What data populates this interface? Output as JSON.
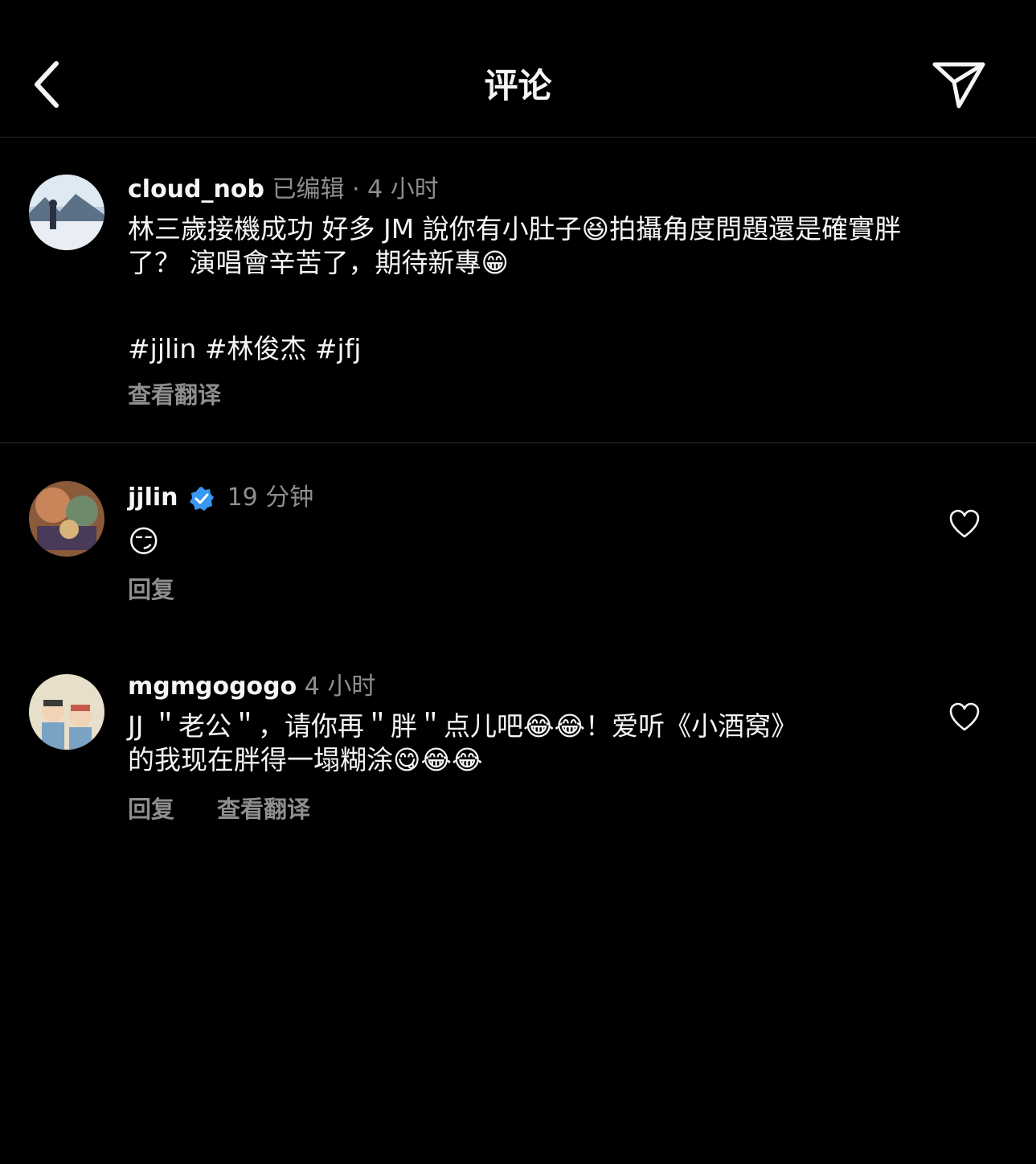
{
  "header": {
    "title": "评论",
    "back_icon": "chevron-left-icon",
    "send_icon": "paper-plane-icon"
  },
  "caption": {
    "username": "cloud_nob",
    "edited": "已编辑",
    "separator": "·",
    "time": "4 小时",
    "text_line1": "林三歲接機成功 好多 JM 說你有小肚子😆拍攝角度問題還是確實胖",
    "text_line2": "了？ 演唱會辛苦了，期待新專😁",
    "hashtags": "#jjlin #林俊杰 #jfj",
    "translate": "查看翻译"
  },
  "comments": [
    {
      "username": "jjlin",
      "verified_icon": "verified-badge-icon",
      "time": "19 分钟",
      "text": "😏",
      "reply": "回复",
      "like_icon": "heart-outline-icon"
    },
    {
      "username": "mgmgogogo",
      "time": "4 小时",
      "text_line1": "JJ ＂老公＂，请你再＂胖＂点儿吧😂😂！爱听《小酒窝》",
      "text_line2": "的我现在胖得一塌糊涂😋😂😂",
      "reply": "回复",
      "translate": "查看翻译",
      "like_icon": "heart-outline-icon"
    }
  ],
  "colors": {
    "background": "#000000",
    "text": "#f5f5f5",
    "secondary": "#8e8e8e",
    "verified": "#3897f0",
    "divider": "#2a2a2a"
  }
}
